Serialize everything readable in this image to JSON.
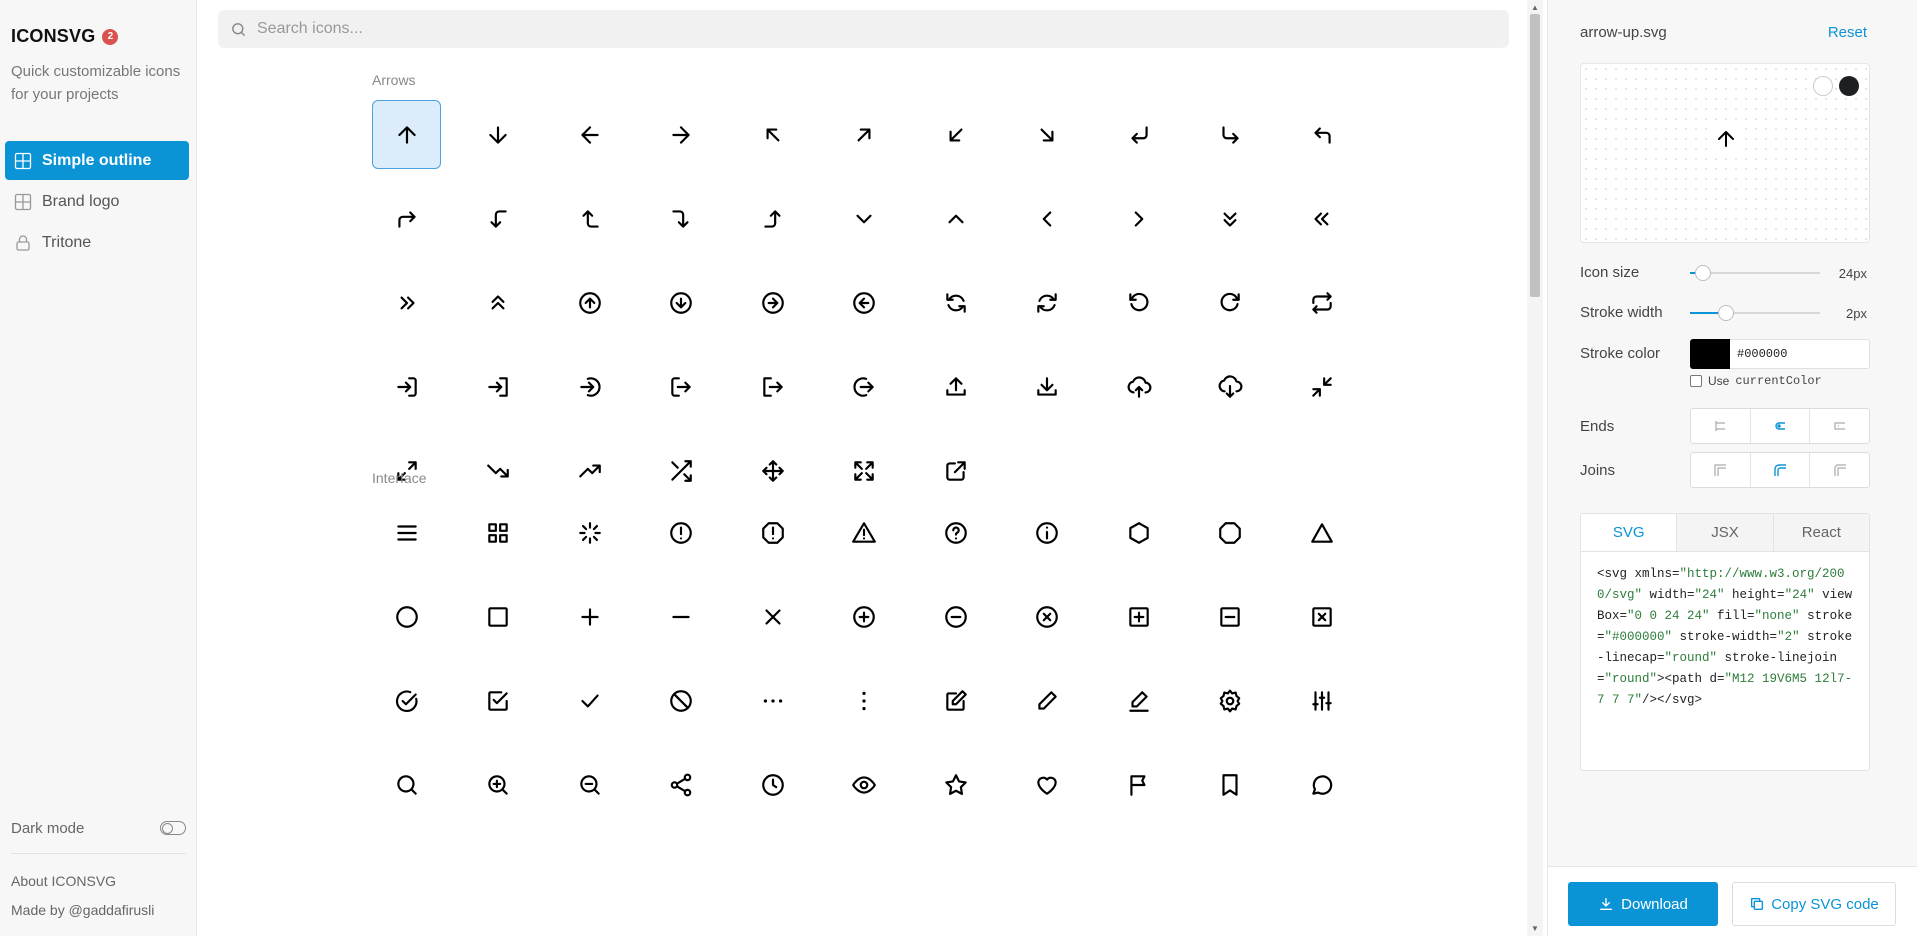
{
  "brand": {
    "name": "ICONSVG",
    "badge": "2",
    "tagline": "Quick customizable icons for your projects"
  },
  "nav": [
    {
      "label": "Simple outline",
      "icon": "grid-icon",
      "active": true
    },
    {
      "label": "Brand logo",
      "icon": "grid-icon",
      "active": false
    },
    {
      "label": "Tritone",
      "icon": "lock-icon",
      "active": false
    }
  ],
  "sidebar_footer": {
    "dark_mode": "Dark mode",
    "about": "About ICONSVG",
    "made_by": "Made by @gaddafirusli"
  },
  "search": {
    "placeholder": "Search icons..."
  },
  "sections": [
    {
      "title": "Arrows",
      "icons": [
        "arrow-up",
        "arrow-down",
        "arrow-left",
        "arrow-right",
        "arrow-up-left",
        "arrow-up-right",
        "arrow-down-left",
        "arrow-down-right",
        "enter-left",
        "corner-down-right",
        "corner-up-left",
        "corner-up-right",
        "corner-left-down",
        "corner-up-left-2",
        "corner-down-right-2",
        "corner-right-up",
        "chevron-down",
        "chevron-up",
        "chevron-left",
        "chevron-right",
        "chevrons-down",
        "chevrons-left",
        "chevrons-right",
        "chevrons-up",
        "arrow-up-circle",
        "arrow-down-circle",
        "arrow-right-circle",
        "arrow-left-circle",
        "refresh-ccw",
        "refresh-cw",
        "rotate-ccw",
        "rotate-cw",
        "repeat",
        "login",
        "login-2",
        "login-circle",
        "logout",
        "logout-2",
        "logout-circle",
        "upload",
        "download",
        "cloud-upload",
        "cloud-download",
        "minimize",
        "maximize",
        "trending-down",
        "trending-up",
        "shuffle",
        "move",
        "maximize-2",
        "external-link"
      ]
    },
    {
      "title": "Interface",
      "icons": [
        "menu",
        "grid",
        "loader",
        "alert-circle",
        "alert-octagon",
        "alert-triangle",
        "help-circle",
        "info",
        "hexagon",
        "octagon",
        "triangle",
        "circle",
        "square",
        "plus",
        "minus",
        "x",
        "plus-circle",
        "minus-circle",
        "x-circle",
        "plus-square",
        "minus-square",
        "x-square",
        "check-circle",
        "check-square",
        "check",
        "slash",
        "more-horizontal",
        "more-vertical",
        "edit",
        "pen",
        "edit-line",
        "settings",
        "sliders",
        "search",
        "zoom-in",
        "zoom-out",
        "share",
        "clock",
        "eye",
        "star",
        "heart",
        "flag",
        "bookmark",
        "message-circle"
      ]
    }
  ],
  "selected_icon": "arrow-up",
  "panel": {
    "file_name": "arrow-up.svg",
    "reset": "Reset",
    "icon_size_label": "Icon size",
    "icon_size_value": "24px",
    "icon_size_fraction": 0.1,
    "stroke_width_label": "Stroke width",
    "stroke_width_value": "2px",
    "stroke_width_fraction": 0.28,
    "stroke_color_label": "Stroke color",
    "stroke_color": "#000000",
    "use_current_color": "Use",
    "use_current_color_code": "currentColor",
    "ends_label": "Ends",
    "joins_label": "Joins",
    "tabs": [
      "SVG",
      "JSX",
      "React"
    ],
    "active_tab": "SVG",
    "download": "Download",
    "copy": "Copy SVG code"
  },
  "code_parts": [
    [
      "t",
      "<svg xmlns="
    ],
    [
      "s",
      "\"http://www.w3.org/2000/svg\""
    ],
    [
      "t",
      " width="
    ],
    [
      "s",
      "\"24\""
    ],
    [
      "t",
      " height="
    ],
    [
      "s",
      "\"24\""
    ],
    [
      "t",
      " viewBox="
    ],
    [
      "s",
      "\"0 0 24 24\""
    ],
    [
      "t",
      " fill="
    ],
    [
      "s",
      "\"none\""
    ],
    [
      "t",
      " stroke="
    ],
    [
      "s",
      "\"#000000\""
    ],
    [
      "t",
      " stroke-width="
    ],
    [
      "s",
      "\"2\""
    ],
    [
      "t",
      " stroke-linecap="
    ],
    [
      "s",
      "\"round\""
    ],
    [
      "t",
      " stroke-linejoin="
    ],
    [
      "s",
      "\"round\""
    ],
    [
      "t",
      "><path d="
    ],
    [
      "s",
      "\"M12 19V6M5 12l7-7 7 7\""
    ],
    [
      "t",
      "/></svg>"
    ]
  ],
  "colors": {
    "accent": "#0a94d6",
    "badge": "#d9534f",
    "selected_bg": "#dcecfa"
  }
}
